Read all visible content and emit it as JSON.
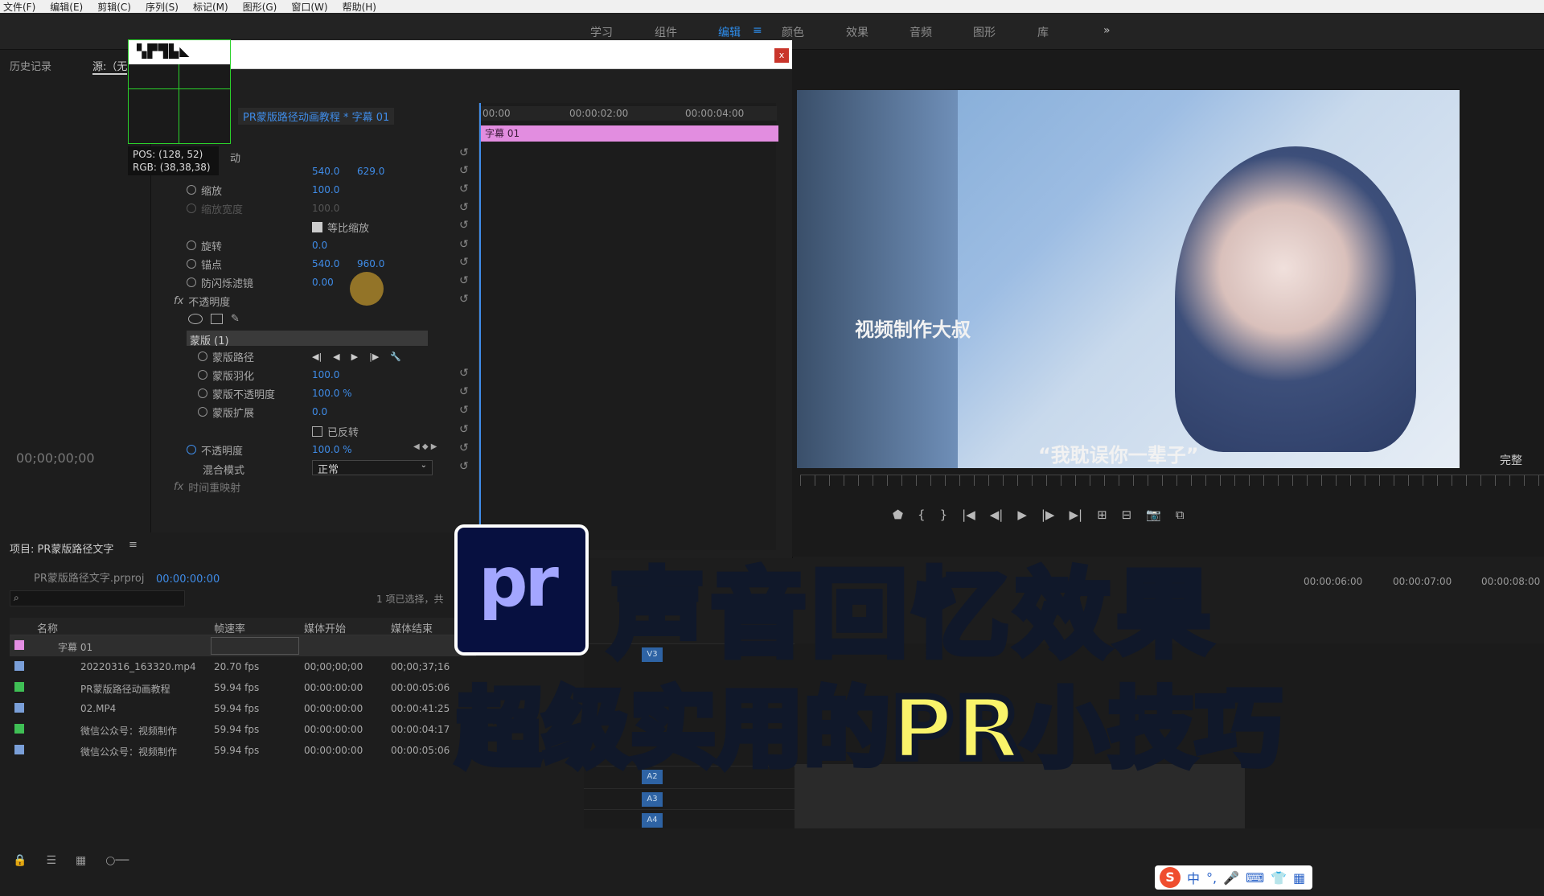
{
  "menu": [
    "文件(F)",
    "编辑(E)",
    "剪辑(C)",
    "序列(S)",
    "标记(M)",
    "图形(G)",
    "窗口(W)",
    "帮助(H)"
  ],
  "workspaces": [
    "学习",
    "组件",
    "编辑",
    "颜色",
    "效果",
    "音频",
    "图形",
    "库"
  ],
  "workspace_active": "编辑",
  "workspace_more": "»",
  "left_panel": {
    "history": "历史记录",
    "source": "源:（无",
    "timecode": "00;00;00;00"
  },
  "loupe": {
    "pos": "POS: (128, 52)",
    "rgb": "RGB: (38,38,38)"
  },
  "effect_controls": {
    "close": "x",
    "sequence": "PR蒙版路径动画教程 * 字幕 01",
    "motion": "动",
    "position": {
      "x": "540.0",
      "y": "629.0"
    },
    "scale": {
      "label": "缩放",
      "value": "100.0"
    },
    "scale_width": {
      "label": "缩放宽度",
      "value": "100.0"
    },
    "uniform": "等比缩放",
    "rotation": {
      "label": "旋转",
      "value": "0.0"
    },
    "anchor": {
      "label": "锚点",
      "x": "540.0",
      "y": "960.0"
    },
    "flicker": {
      "label": "防闪烁滤镜",
      "value": "0.00"
    },
    "opacity_group": "不透明度",
    "mask": "蒙版 (1)",
    "mask_path": "蒙版路径",
    "mask_feather": {
      "label": "蒙版羽化",
      "value": "100.0"
    },
    "mask_opacity": {
      "label": "蒙版不透明度",
      "value": "100.0 %"
    },
    "mask_expand": {
      "label": "蒙版扩展",
      "value": "0.0"
    },
    "inverted": "已反转",
    "opacity": {
      "label": "不透明度",
      "value": "100.0 %"
    },
    "blend": {
      "label": "混合模式",
      "value": "正常"
    },
    "time_remap": "时间重映射"
  },
  "mini_timeline": {
    "t0": "00:00",
    "t1": "00:00:02:00",
    "t2": "00:00:04:00",
    "clip": "字幕 01"
  },
  "program": {
    "subtitle1": "视频制作大叔",
    "subtitle2": "“我耽误你一辈子”",
    "fit": "完整"
  },
  "project": {
    "title": "项目: PR蒙版路径文字",
    "file": "PR蒙版路径文字.prproj",
    "timecode": "00:00:00:00",
    "selection": "1 项已选择，共",
    "columns": [
      "名称",
      "帧速率",
      "媒体开始",
      "媒体结束"
    ],
    "rows": [
      {
        "name": "字幕 01",
        "fps": "",
        "start": "",
        "end": "",
        "color": "#e48ee3"
      },
      {
        "name": "20220316_163320.mp4",
        "fps": "20.70 fps",
        "start": "00;00;00;00",
        "end": "00;00;37;16",
        "color": "#7a9fd8"
      },
      {
        "name": "PR蒙版路径动画教程",
        "fps": "59.94 fps",
        "start": "00:00:00:00",
        "end": "00:00:05:06",
        "color": "#3fbf55"
      },
      {
        "name": "02.MP4",
        "fps": "59.94 fps",
        "start": "00:00:00:00",
        "end": "00:00:41:25",
        "color": "#7a9fd8"
      },
      {
        "name": "微信公众号：视频制作",
        "fps": "59.94 fps",
        "start": "00:00:00:00",
        "end": "00:00:04:17",
        "color": "#3fbf55"
      },
      {
        "name": "微信公众号：视频制作",
        "fps": "59.94 fps",
        "start": "00:00:00:00",
        "end": "00:00:05:06",
        "color": "#7a9fd8"
      }
    ]
  },
  "timeline": {
    "t6": "00:00:06:00",
    "t7": "00:00:07:00",
    "t8": "00:00:08:00",
    "tracks": [
      "V3",
      "A2",
      "A3",
      "A4"
    ]
  },
  "overlay": {
    "logo": "pr",
    "title1": "声音回忆效果",
    "title2": "超级实用的PR小技巧"
  },
  "ime": {
    "s": "S",
    "lang": "中"
  }
}
